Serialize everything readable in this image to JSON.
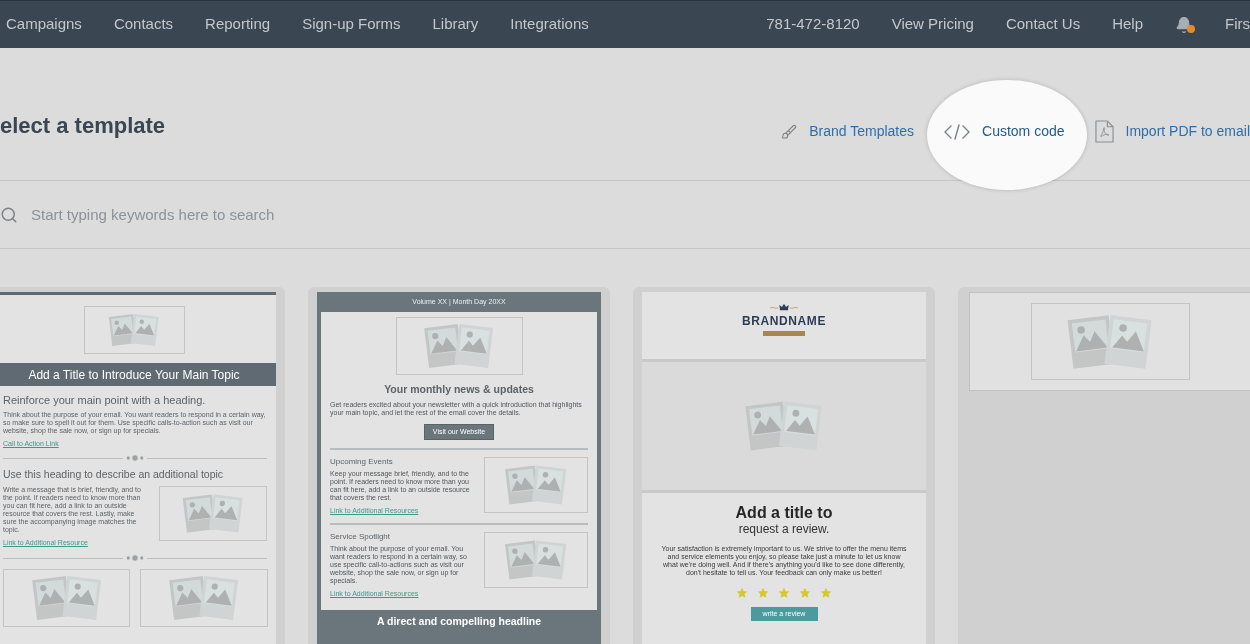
{
  "nav": {
    "items": [
      {
        "label": "Campaigns"
      },
      {
        "label": "Contacts"
      },
      {
        "label": "Reporting"
      },
      {
        "label": "Sign-up Forms"
      },
      {
        "label": "Library"
      },
      {
        "label": "Integrations"
      }
    ],
    "phone": "781-472-8120",
    "links": [
      {
        "label": "View Pricing"
      },
      {
        "label": "Contact Us"
      },
      {
        "label": "Help"
      }
    ],
    "notification": true,
    "account": "Firs"
  },
  "header": {
    "title": "elect a template",
    "actions": [
      {
        "kind": "brush",
        "label": "Brand Templates",
        "highlighted": false
      },
      {
        "kind": "code",
        "label": "Custom code",
        "highlighted": true
      },
      {
        "kind": "pdf",
        "label": "Import PDF to email",
        "highlighted": false
      }
    ]
  },
  "search": {
    "placeholder": "Start typing keywords here to search"
  },
  "templates": [
    {
      "kind": "topic",
      "banner": "Add a Title to Introduce Your Main Topic",
      "heading": "Reinforce your main point with a heading.",
      "body": "Think about the purpose of your email. You want readers to respond in a certain way, so make sure to spell it out for them. Use specific calls-to-action such as visit our website, shop the sale now, or sign up for specials.",
      "link": "Call to Action Link",
      "subheading": "Use this heading to describe an additional topic",
      "subbody": "Write a message that is brief, friendly, and to the point. If readers need to know more than you can fit here, add a link to an outside resource that covers the rest. Lastly, make sure the accompanying image matches the topic.",
      "sublink": "Link to Additional Resource"
    },
    {
      "kind": "newsletter",
      "issue": "Volume XX | Month Day 20XX",
      "title": "Your monthly news & updates",
      "intro": "Get readers excited about your newsletter with a quick introduction that highlights your main topic, and let the rest of the email cover the details.",
      "button": "Visit our Website",
      "sections": [
        {
          "heading": "Upcoming Events",
          "body": "Keep your message brief, friendly, and to the point. If readers need to know more than you can fit here, add a link to an outside resource that covers the rest.",
          "link": "Link to Additional Resources"
        },
        {
          "heading": "Service Spotlight",
          "body": "Think about the purpose of your email. You want readers to respond in a certain way, so use specific call-to-actions such as visit our website, shop the sale now, or sign up for specials.",
          "link": "Link to Additional Resources"
        }
      ],
      "footer": "A direct and compelling headline"
    },
    {
      "kind": "review",
      "brand": "BRANDNAME",
      "title": "Add a title to",
      "subtitle": "request a review.",
      "body": "Your satisfaction is extremely important to us. We strive to offer the menu items and service elements you enjoy, so please take just a minute to let us know what we're doing well. And if there's anything you'd like to see done differently, don't hesitate to tell us. Your feedback can only make us better!",
      "stars": 5,
      "button": "write a review"
    },
    {
      "kind": "image_header"
    }
  ]
}
